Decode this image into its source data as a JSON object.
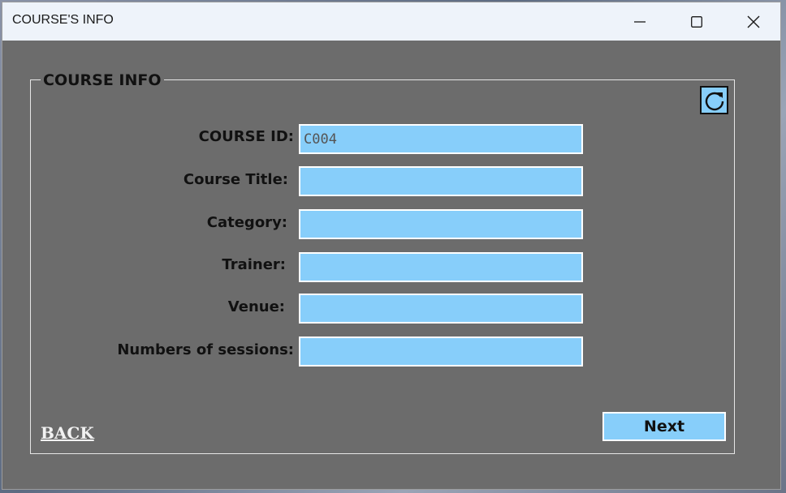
{
  "window": {
    "title": "COURSE'S INFO"
  },
  "group": {
    "legend": "COURSE INFO"
  },
  "form": {
    "fields": [
      {
        "label": "COURSE ID:",
        "value": "C004"
      },
      {
        "label": "Course Title:",
        "value": ""
      },
      {
        "label": "Category:",
        "value": ""
      },
      {
        "label": "Trainer:",
        "value": ""
      },
      {
        "label": "Venue:",
        "value": ""
      },
      {
        "label": "Numbers of sessions:",
        "value": ""
      }
    ]
  },
  "actions": {
    "back_label": "BACK",
    "next_label": "Next"
  },
  "icons": {
    "refresh": "refresh-icon",
    "minimize": "minimize-icon",
    "maximize": "maximize-icon",
    "close": "close-icon"
  },
  "colors": {
    "window_bg": "#6c6c6c",
    "field_bg": "#87cefa",
    "titlebar_bg": "#eef3fa"
  }
}
